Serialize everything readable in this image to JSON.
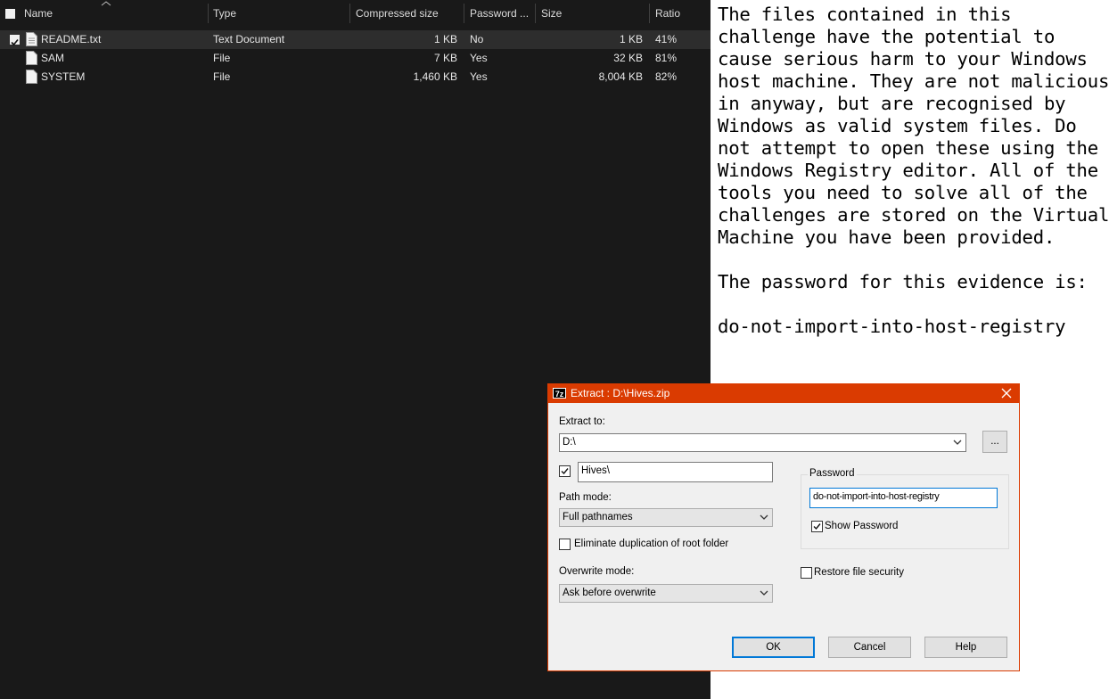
{
  "explorer": {
    "columns": {
      "name": "Name",
      "type": "Type",
      "compressed": "Compressed size",
      "password": "Password ...",
      "size": "Size",
      "ratio": "Ratio"
    },
    "files": [
      {
        "name": "README.txt",
        "type": "Text Document",
        "compressed": "1 KB",
        "password": "No",
        "size": "1 KB",
        "ratio": "41%",
        "checked": true
      },
      {
        "name": "SAM",
        "type": "File",
        "compressed": "7 KB",
        "password": "Yes",
        "size": "32 KB",
        "ratio": "81%",
        "checked": false
      },
      {
        "name": "SYSTEM",
        "type": "File",
        "compressed": "1,460 KB",
        "password": "Yes",
        "size": "8,004 KB",
        "ratio": "82%",
        "checked": false
      }
    ]
  },
  "notepad": {
    "text": "The files contained in this challenge have the potential to cause serious harm to your Windows host machine. They are not malicious in anyway, but are recognised by Windows as valid system files. Do not attempt to open these using the Windows Registry editor. All of the tools you need to solve all of the challenges are stored on the Virtual Machine you have been provided.\n\nThe password for this evidence is:\n\ndo-not-import-into-host-registry"
  },
  "dialog": {
    "icon_text": "7z",
    "title": "Extract : D:\\Hives.zip",
    "extract_to_label": "Extract to:",
    "extract_to_value": "D:\\",
    "browse_label": "...",
    "subfolder_value": "Hives\\",
    "path_mode_label": "Path mode:",
    "path_mode_value": "Full pathnames",
    "eliminate_label": "Eliminate duplication of root folder",
    "overwrite_label": "Overwrite mode:",
    "overwrite_value": "Ask before overwrite",
    "password_group_label": "Password",
    "password_value": "do-not-import-into-host-registry",
    "show_password_label": "Show Password",
    "restore_security_label": "Restore file security",
    "ok_label": "OK",
    "cancel_label": "Cancel",
    "help_label": "Help"
  }
}
